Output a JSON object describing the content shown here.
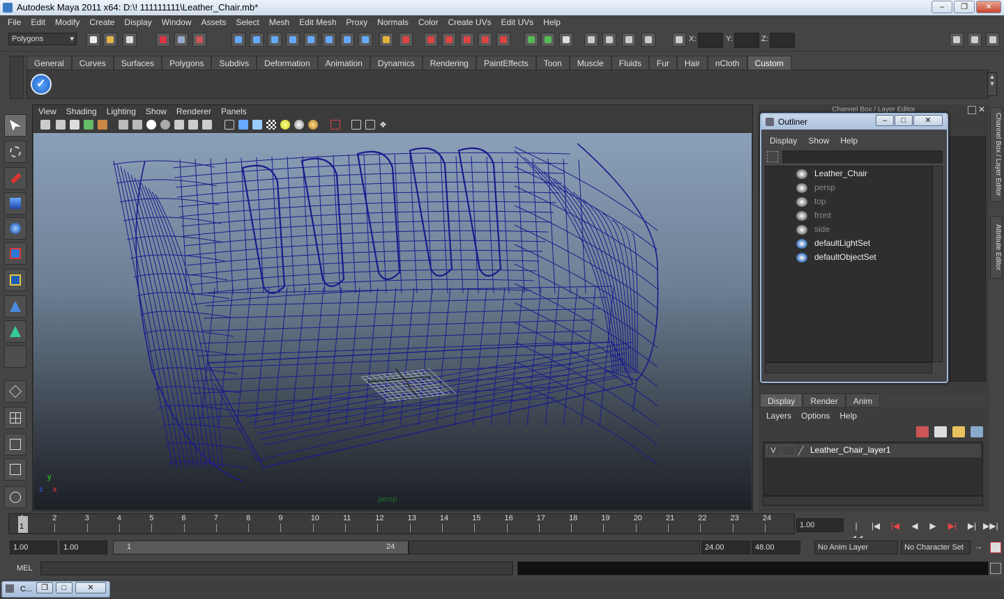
{
  "window": {
    "title": "Autodesk Maya 2011 x64: D:\\! 111111111\\Leather_Chair.mb*",
    "minimize_icon": "minimize-icon",
    "restore_icon": "restore-icon",
    "close_icon": "close-icon"
  },
  "menubar": [
    "File",
    "Edit",
    "Modify",
    "Create",
    "Display",
    "Window",
    "Assets",
    "Select",
    "Mesh",
    "Edit Mesh",
    "Proxy",
    "Normals",
    "Color",
    "Create UVs",
    "Edit UVs",
    "Help"
  ],
  "statusline": {
    "mode": "Polygons",
    "x_label": "X:",
    "y_label": "Y:",
    "z_label": "Z:"
  },
  "shelf": {
    "tabs": [
      "General",
      "Curves",
      "Surfaces",
      "Polygons",
      "Subdivs",
      "Deformation",
      "Animation",
      "Dynamics",
      "Rendering",
      "PaintEffects",
      "Toon",
      "Muscle",
      "Fluids",
      "Fur",
      "Hair",
      "nCloth",
      "Custom"
    ],
    "active_tab": "Custom",
    "custom_icon": "check-icon"
  },
  "viewport": {
    "menu": [
      "View",
      "Shading",
      "Lighting",
      "Show",
      "Renderer",
      "Panels"
    ],
    "camera_label": "persp",
    "axis_x": "x",
    "axis_y": "y",
    "axis_z": "z",
    "wireframe_color": "#1a1a8c"
  },
  "right_panel": {
    "header": "Channel Box / Layer Editor",
    "side_tabs": [
      "Channel Box / Layer Editor",
      "Attribute Editor"
    ]
  },
  "outliner": {
    "title": "Outliner",
    "menu": [
      "Display",
      "Show",
      "Help"
    ],
    "items": [
      {
        "label": "Leather_Chair",
        "dim": false
      },
      {
        "label": "persp",
        "dim": true
      },
      {
        "label": "top",
        "dim": true
      },
      {
        "label": "front",
        "dim": true
      },
      {
        "label": "side",
        "dim": true
      },
      {
        "label": "defaultLightSet",
        "dim": false
      },
      {
        "label": "defaultObjectSet",
        "dim": false
      }
    ]
  },
  "layers": {
    "tabs": [
      "Display",
      "Render",
      "Anim"
    ],
    "active_tab": "Display",
    "menu": [
      "Layers",
      "Options",
      "Help"
    ],
    "rows": [
      {
        "visible": "V",
        "name": "Leather_Chair_layer1"
      }
    ]
  },
  "timeline": {
    "ticks": [
      "1",
      "2",
      "3",
      "4",
      "5",
      "6",
      "7",
      "8",
      "9",
      "10",
      "11",
      "12",
      "13",
      "14",
      "15",
      "16",
      "17",
      "18",
      "19",
      "20",
      "21",
      "22",
      "23",
      "24"
    ],
    "current_frame": "1",
    "current_time": "1.00"
  },
  "range": {
    "start_time": "1.00",
    "playback_start": "1.00",
    "range_start_label": "1",
    "range_end_label": "24",
    "playback_end": "24.00",
    "end_time": "48.00",
    "anim_layer": "No Anim Layer",
    "character_set": "No Character Set"
  },
  "command": {
    "label": "MEL"
  },
  "taskbar": {
    "label": "C..."
  }
}
